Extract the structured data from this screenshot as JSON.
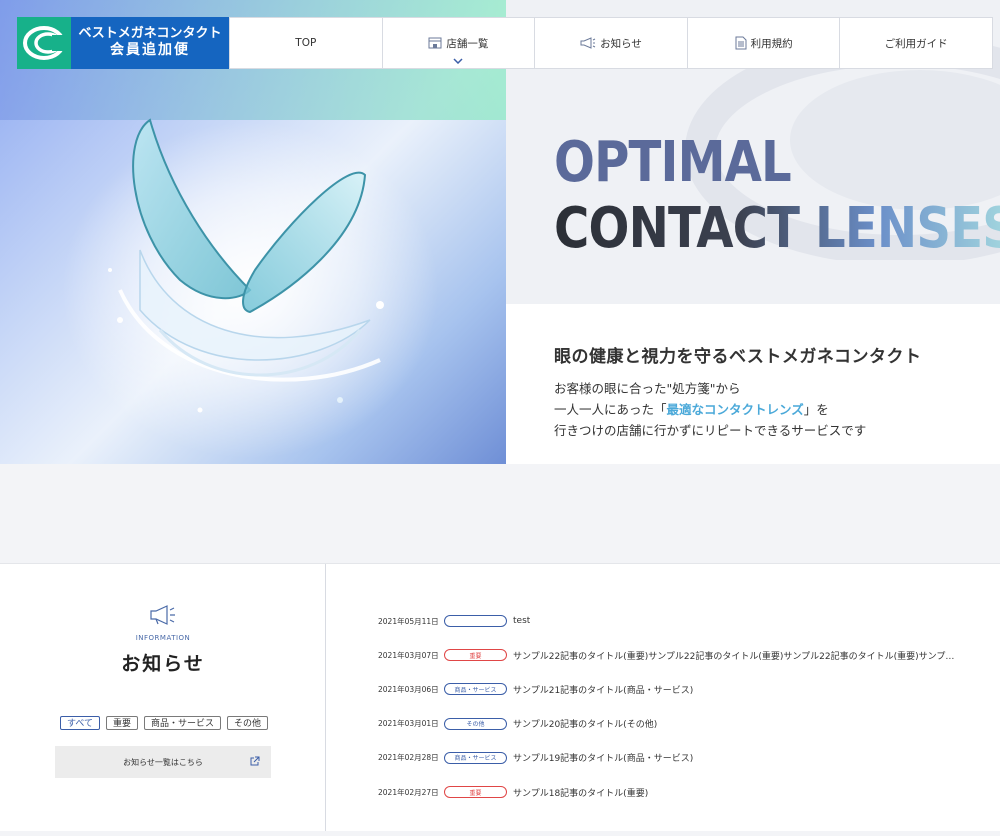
{
  "logo": {
    "line1": "ベストメガネコンタクト",
    "line2": "会員追加便",
    "mark_icon": "brand-circle-logo"
  },
  "nav": {
    "items": [
      {
        "label": "TOP",
        "icon": ""
      },
      {
        "label": "店舗一覧",
        "icon": "store-icon"
      },
      {
        "label": "お知らせ",
        "icon": "megaphone-icon"
      },
      {
        "label": "利用規約",
        "icon": "document-icon"
      },
      {
        "label": "ご利用ガイド",
        "icon": ""
      }
    ]
  },
  "hero": {
    "title_line1": "OPTIMAL",
    "title_line2": "CONTACT LENSES",
    "tagline": "眼の健康と視力を守るベストメガネコンタクト",
    "desc_line1": "お客様の眼に合った\"処方箋\"から",
    "desc_line2_pre": "一人一人にあった「",
    "desc_line2_hl": "最適なコンタクトレンズ",
    "desc_line2_post": "」を",
    "desc_line3": "行きつけの店舗に行かずにリピートできるサービスです"
  },
  "info": {
    "eyebrow": "INFORMATION",
    "title": "お知らせ",
    "filters": [
      "すべて",
      "重要",
      "商品・サービス",
      "その他"
    ],
    "all_link": "お知らせ一覧はこちら",
    "items": [
      {
        "date": "2021年05月11日",
        "tag": "",
        "title": "test"
      },
      {
        "date": "2021年03月07日",
        "tag": "重要",
        "title": "サンプル22記事のタイトル(重要)サンプル22記事のタイトル(重要)サンプル22記事のタイトル(重要)サンプル22記事の..."
      },
      {
        "date": "2021年03月06日",
        "tag": "商品・サービス",
        "title": "サンプル21記事のタイトル(商品・サービス)"
      },
      {
        "date": "2021年03月01日",
        "tag": "その他",
        "title": "サンプル20記事のタイトル(その他)"
      },
      {
        "date": "2021年02月28日",
        "tag": "商品・サービス",
        "title": "サンプル19記事のタイトル(商品・サービス)"
      },
      {
        "date": "2021年02月27日",
        "tag": "重要",
        "title": "サンプル18記事のタイトル(重要)"
      }
    ]
  },
  "colors": {
    "brand_green": "#17b18a",
    "brand_blue": "#1565c0",
    "tag_blue": "#3b5ea8",
    "tag_red": "#e04646",
    "highlight": "#4ba9d9"
  }
}
